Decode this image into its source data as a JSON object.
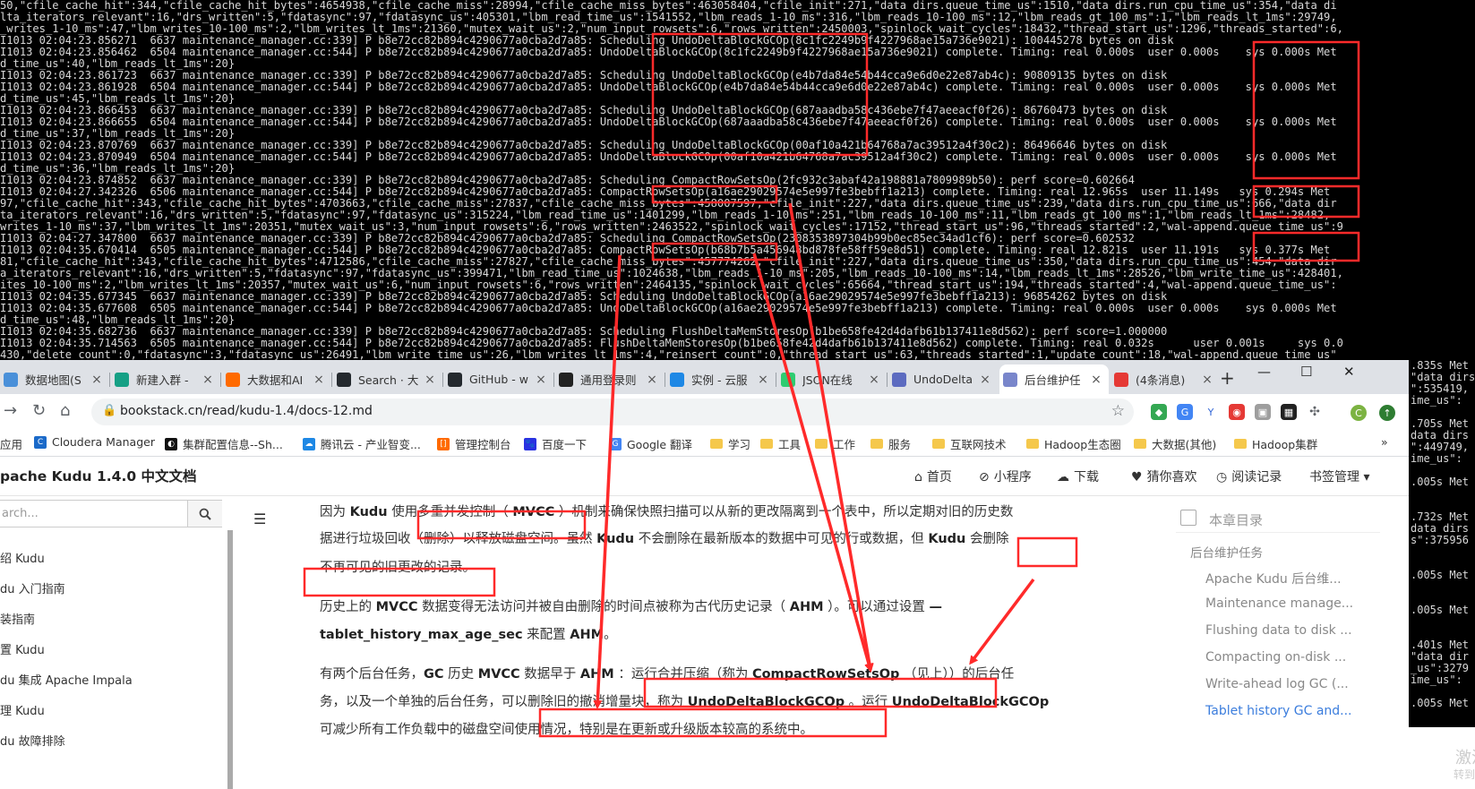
{
  "terminal": {
    "lines": [
      "50,\"cfile_cache_hit\":344,\"cfile_cache_hit_bytes\":4654938,\"cfile_cache_miss\":28994,\"cfile_cache_miss_bytes\":463058404,\"cfile_init\":271,\"data dirs.queue_time_us\":1510,\"data dirs.run_cpu_time_us\":354,\"data di",
      "lta_iterators_relevant\":16,\"drs_written\":5,\"fdatasync\":97,\"fdatasync_us\":405301,\"lbm_read_time_us\":1541552,\"lbm_reads_1-10_ms\":316,\"lbm_reads_10-100_ms\":12,\"lbm_reads_gt_100_ms\":1,\"lbm_reads_lt_1ms\":29749,",
      "_writes_1-10_ms\":47,\"lbm_writes_10-100_ms\":2,\"lbm_writes_lt_1ms\":21360,\"mutex_wait_us\":2,\"num_input_rowsets\":6,\"rows_written\":2450003,\"spinlock_wait_cycles\":18432,\"thread_start_us\":1296,\"threads_started\":6,",
      "I1013 02:04:23.856271  6637 maintenance_manager.cc:339] P b8e72cc82b894c4290677a0cba2d7a85: Scheduling UndoDeltaBlockGCOp(8c1fc2249b9f4227968ae15a736e9021): 100445278 bytes on disk",
      "I1013 02:04:23.856462  6504 maintenance_manager.cc:544] P b8e72cc82b894c4290677a0cba2d7a85: UndoDeltaBlockGCOp(8c1fc2249b9f4227968ae15a736e9021) complete. Timing: real 0.000s  user 0.000s    sys 0.000s Met",
      "d_time_us\":40,\"lbm_reads_lt_1ms\":20}",
      "I1013 02:04:23.861723  6637 maintenance_manager.cc:339] P b8e72cc82b894c4290677a0cba2d7a85: Scheduling UndoDeltaBlockGCOp(e4b7da84e54b44cca9e6d0e22e87ab4c): 90809135 bytes on disk",
      "I1013 02:04:23.861928  6504 maintenance_manager.cc:544] P b8e72cc82b894c4290677a0cba2d7a85: UndoDeltaBlockGCOp(e4b7da84e54b44cca9e6d0e22e87ab4c) complete. Timing: real 0.000s  user 0.000s    sys 0.000s Met",
      "d_time_us\":45,\"lbm_reads_lt_1ms\":20}",
      "I1013 02:04:23.866453  6637 maintenance_manager.cc:339] P b8e72cc82b894c4290677a0cba2d7a85: Scheduling UndoDeltaBlockGCOp(687aaadba58c436ebe7f47aeeacf0f26): 86760473 bytes on disk",
      "I1013 02:04:23.866655  6504 maintenance_manager.cc:544] P b8e72cc82b894c4290677a0cba2d7a85: UndoDeltaBlockGCOp(687aaadba58c436ebe7f47aeeacf0f26) complete. Timing: real 0.000s  user 0.000s    sys 0.000s Met",
      "d_time_us\":37,\"lbm_reads_lt_1ms\":20}",
      "I1013 02:04:23.870769  6637 maintenance_manager.cc:339] P b8e72cc82b894c4290677a0cba2d7a85: Scheduling UndoDeltaBlockGCOp(00af10a421b64768a7ac39512a4f30c2): 86496646 bytes on disk",
      "I1013 02:04:23.870949  6504 maintenance_manager.cc:544] P b8e72cc82b894c4290677a0cba2d7a85: UndoDeltaBlockGCOp(00af10a421b64768a7ac39512a4f30c2) complete. Timing: real 0.000s  user 0.000s    sys 0.000s Met",
      "d_time_us\":36,\"lbm_reads_lt_1ms\":20}",
      "I1013 02:04:23.874852  6637 maintenance_manager.cc:339] P b8e72cc82b894c4290677a0cba2d7a85: Scheduling CompactRowSetsOp(2fc932c3abaf42a198881a7809989b50): perf score=0.602664",
      "I1013 02:04:27.342326  6506 maintenance_manager.cc:544] P b8e72cc82b894c4290677a0cba2d7a85: CompactRowSetsOp(a16ae29029574e5e997fe3bebff1a213) complete. Timing: real 12.965s  user 11.149s   sys 0.294s Met",
      "97,\"cfile_cache_hit\":343,\"cfile_cache_hit_bytes\":4703663,\"cfile_cache_miss\":27837,\"cfile_cache_miss_bytes\":458007597,\"cfile_init\":227,\"data dirs.queue_time_us\":239,\"data dirs.run_cpu_time_us\":666,\"data dir",
      "ta_iterators_relevant\":16,\"drs_written\":5,\"fdatasync\":97,\"fdatasync_us\":315224,\"lbm_read_time_us\":1401299,\"lbm_reads_1-10_ms\":251,\"lbm_reads_10-100_ms\":11,\"lbm_reads_gt_100_ms\":1,\"lbm_reads_lt_1ms\":28482,",
      "writes_1-10_ms\":37,\"lbm_writes_lt_1ms\":20351,\"mutex_wait_us\":3,\"num_input_rowsets\":6,\"rows_written\":2463522,\"spinlock_wait_cycles\":17152,\"thread_start_us\":96,\"threads_started\":2,\"wal-append.queue_time_us\":9",
      "I1013 02:04:27.347800  6637 maintenance_manager.cc:339] P b8e72cc82b894c4290677a0cba2d7a85: Scheduling CompactRowSetsOp(2308353897304b99b0ec85ec34ad1cf6): perf score=0.602532",
      "I1013 02:04:35.670414  6505 maintenance_manager.cc:544] P b8e72cc82b894c4290677a0cba2d7a85: CompactRowSetsOp(b68b7b5a456948bd878fe58ff59e8d51) complete. Timing: real 12.821s  user 11.191s   sys 0.377s Met",
      "81,\"cfile_cache_hit\":343,\"cfile_cache_hit_bytes\":4712586,\"cfile_cache_miss\":27827,\"cfile_cache_miss_bytes\":457774262,\"cfile_init\":227,\"data dirs.queue_time_us\":350,\"data dirs.run_cpu_time_us\":454,\"data dir",
      "a_iterators_relevant\":16,\"drs_written\":5,\"fdatasync\":97,\"fdatasync_us\":399471,\"lbm_read_time_us\":1024638,\"lbm_reads_1-10_ms\":205,\"lbm_reads_10-100_ms\":14,\"lbm_reads_lt_1ms\":28526,\"lbm_write_time_us\":428401,",
      "ites_10-100_ms\":2,\"lbm_writes_lt_1ms\":20357,\"mutex_wait_us\":6,\"num_input_rowsets\":6,\"rows_written\":2464135,\"spinlock_wait_cycles\":65664,\"thread_start_us\":194,\"threads_started\":4,\"wal-append.queue_time_us\":",
      "I1013 02:04:35.677345  6637 maintenance_manager.cc:339] P b8e72cc82b894c4290677a0cba2d7a85: Scheduling UndoDeltaBlockGCOp(a16ae29029574e5e997fe3bebff1a213): 96854262 bytes on disk",
      "I1013 02:04:35.677608  6505 maintenance_manager.cc:544] P b8e72cc82b894c4290677a0cba2d7a85: UndoDeltaBlockGCOp(a16ae29029574e5e997fe3bebff1a213) complete. Timing: real 0.000s  user 0.000s    sys 0.000s Met",
      "d_time_us\":48,\"lbm_reads_lt_1ms\":20}",
      "I1013 02:04:35.682736  6637 maintenance_manager.cc:339] P b8e72cc82b894c4290677a0cba2d7a85: Scheduling FlushDeltaMemStoresOp(b1be658fe42d4dafb61b137411e8d562): perf score=1.000000",
      "I1013 02:04:35.714563  6505 maintenance_manager.cc:544] P b8e72cc82b894c4290677a0cba2d7a85: FlushDeltaMemStoresOp(b1be658fe42d4dafb61b137411e8d562) complete. Timing: real 0.032s      user 0.001s     sys 0.0",
      "430,\"delete_count\":0,\"fdatasync\":3,\"fdatasync_us\":26491,\"lbm_write_time_us\":26,\"lbm_writes_lt_1ms\":4,\"reinsert_count\":0,\"thread_start_us\":63,\"threads_started\":1,\"update_count\":18,\"wal-append.queue_time_us\""
    ],
    "right_lines": [
      ".835s Met",
      "\"data dirs",
      "\":535419,",
      "ime_us\":",
      "",
      ".705s Met",
      "data dirs",
      "\":449749,",
      "ime_us\":",
      "",
      ".005s Met",
      "",
      "",
      ".732s Met",
      "data dirs",
      "s\":375956",
      "",
      "",
      ".005s Met",
      "",
      "",
      ".005s Met",
      "",
      "",
      ".401s Met",
      "\"data dir",
      "_us\":3279",
      "ime_us\":",
      "",
      ".005s Met"
    ],
    "corner_text_1": "激活",
    "corner_text_2": "转到"
  },
  "browser": {
    "tabs": [
      {
        "label": "数据地图(S",
        "icon": "doc-icon",
        "color": "#4a90d9"
      },
      {
        "label": "新建入群 -",
        "icon": "play-icon",
        "color": "#16a085"
      },
      {
        "label": "大数据和AI",
        "icon": "bracket-icon",
        "color": "#ff6a00"
      },
      {
        "label": "Search · 大",
        "icon": "github-icon",
        "color": "#24292e"
      },
      {
        "label": "GitHub - w",
        "icon": "github-icon",
        "color": "#24292e"
      },
      {
        "label": "通用登录则",
        "icon": "dark-icon",
        "color": "#222222"
      },
      {
        "label": "实例 - 云服",
        "icon": "cloud-icon",
        "color": "#1e88e5"
      },
      {
        "label": "JSON在线",
        "icon": "json-icon",
        "color": "#2ecc71"
      },
      {
        "label": "UndoDelta",
        "icon": "gear-icon",
        "color": "#5c6bc0"
      },
      {
        "label": "后台维护任",
        "icon": "doc-icon",
        "color": "#7986cb"
      },
      {
        "label": "(4条消息)",
        "icon": "c-icon",
        "color": "#e53935"
      }
    ],
    "window_controls": {
      "minimize": "—",
      "maximize": "☐",
      "close": "✕"
    },
    "url": "bookstack.cn/read/kudu-1.4/docs-12.md",
    "bookmarks": [
      {
        "label": "应用",
        "type": "apps"
      },
      {
        "label": "Cloudera Manager",
        "type": "site",
        "color": "#1b6ac9",
        "glyph": "C"
      },
      {
        "label": "集群配置信息--Sh...",
        "type": "site",
        "color": "#111111",
        "glyph": "◐"
      },
      {
        "label": "腾讯云 - 产业智变...",
        "type": "site",
        "color": "#1e88e5",
        "glyph": "☁"
      },
      {
        "label": "管理控制台",
        "type": "site",
        "color": "#ff6a00",
        "glyph": "[]"
      },
      {
        "label": "百度一下",
        "type": "site",
        "color": "#2932e1",
        "glyph": "🐾"
      },
      {
        "label": "Google 翻译",
        "type": "site",
        "color": "#4285f4",
        "glyph": "G"
      },
      {
        "label": "学习",
        "type": "folder"
      },
      {
        "label": "工具",
        "type": "folder"
      },
      {
        "label": "工作",
        "type": "folder"
      },
      {
        "label": "服务",
        "type": "folder"
      },
      {
        "label": "互联网技术",
        "type": "folder"
      },
      {
        "label": "Hadoop生态圈",
        "type": "folder"
      },
      {
        "label": "大数据(其他)",
        "type": "folder"
      },
      {
        "label": "Hadoop集群",
        "type": "folder"
      }
    ],
    "bookmarks_more": "»"
  },
  "page": {
    "site_title": "pache Kudu 1.4.0 中文文档",
    "nav": [
      {
        "icon": "home-icon",
        "glyph": "⌂",
        "label": "首页"
      },
      {
        "icon": "mini-program-icon",
        "glyph": "⊘",
        "label": "小程序"
      },
      {
        "icon": "download-icon",
        "glyph": "☁",
        "label": "下载"
      },
      {
        "icon": "heart-icon",
        "glyph": "♥",
        "label": "猜你喜欢"
      },
      {
        "icon": "clock-icon",
        "glyph": "◷",
        "label": "阅读记录"
      },
      {
        "icon": "bookmark-icon",
        "glyph": "",
        "label": "书签管理 ▾"
      }
    ],
    "search_placeholder": "arch...",
    "left_toc": [
      "绍 Kudu",
      "du 入门指南",
      "装指南",
      "置 Kudu",
      "du 集成 Apache Impala",
      "理 Kudu",
      "du 故障排除"
    ],
    "paragraphs": [
      "因为 <b>Kudu</b> 使用多重并发控制（ <b>MVCC</b> ）机制来确保快照扫描可以从新的更改隔离到一个表中，所以定期对旧的历史数",
      "据进行垃圾回收（删除）以释放磁盘空间。虽然 <b>Kudu</b> 不会删除在最新版本的数据中可见的行或数据，但 <b>Kudu</b> 会删除",
      "不再可见的旧更改的记录。",
      "历史上的 <b>MVCC</b> 数据变得无法访问并被自由删除的时间点被称为古代历史记录（ <b>AHM</b> ）。可以通过设置 <b>—</b>",
      "<b>tablet_history_max_age_sec</b> 来配置 <b>AHM</b>。",
      "有两个后台任务，<b>GC</b> 历史 <b>MVCC</b> 数据早于 <b>AHM</b> ：运行合并压缩（称为 <b>CompactRowSetsOp</b> （见上））的后台任",
      "务，以及一个单独的后台任务，可以删除旧的撤消增量块，称为 <b>UndoDeltaBlockGCOp</b> 。运行 <b>UndoDeltaBlockGCOp</b>",
      "可减少所有工作负载中的磁盘空间使用情况，特别是在更新或升级版本较高的系统中。"
    ],
    "side_toc": {
      "title": "本章目录",
      "section": "后台维护任务",
      "items": [
        {
          "label": "Apache Kudu 后台维...",
          "active": false
        },
        {
          "label": "Maintenance manage...",
          "active": false
        },
        {
          "label": "Flushing data to disk ...",
          "active": false
        },
        {
          "label": "Compacting on-disk ...",
          "active": false
        },
        {
          "label": "Write-ahead log GC (...",
          "active": false
        },
        {
          "label": "Tablet history GC and...",
          "active": true
        }
      ]
    }
  },
  "colors": {
    "annotation": "#ff2a2a",
    "link": "#3b7ddd"
  }
}
